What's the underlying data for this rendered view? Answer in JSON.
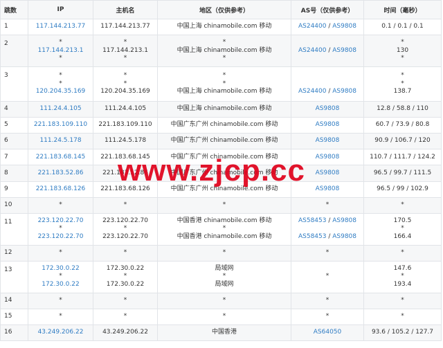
{
  "headers": [
    "跳数",
    "IP",
    "主机名",
    "地区（仅供参考）",
    "AS号（仅供参考）",
    "时间（毫秒）"
  ],
  "rows": [
    {
      "hop": "1",
      "lines": [
        {
          "ip": "117.144.213.77",
          "host": "117.144.213.77",
          "region": "中国上海 chinamobile.com 移动",
          "as1": "AS24400",
          "as2": "AS9808",
          "time": "0.1 / 0.1 / 0.1"
        }
      ]
    },
    {
      "hop": "2",
      "lines": [
        {
          "ip": "*",
          "host": "*",
          "region": "*",
          "as1": "",
          "as2": "",
          "time": "*"
        },
        {
          "ip": "117.144.213.1",
          "host": "117.144.213.1",
          "region": "中国上海 chinamobile.com 移动",
          "as1": "AS24400",
          "as2": "AS9808",
          "time": "130"
        },
        {
          "ip": "*",
          "host": "*",
          "region": "*",
          "as1": "",
          "as2": "",
          "time": "*"
        }
      ]
    },
    {
      "hop": "3",
      "lines": [
        {
          "ip": "*",
          "host": "*",
          "region": "*",
          "as1": "",
          "as2": "",
          "time": "*"
        },
        {
          "ip": "*",
          "host": "*",
          "region": "*",
          "as1": "",
          "as2": "",
          "time": "*"
        },
        {
          "ip": "120.204.35.169",
          "host": "120.204.35.169",
          "region": "中国上海 chinamobile.com 移动",
          "as1": "AS24400",
          "as2": "AS9808",
          "time": "138.7"
        }
      ]
    },
    {
      "hop": "4",
      "lines": [
        {
          "ip": "111.24.4.105",
          "host": "111.24.4.105",
          "region": "中国上海 chinamobile.com 移动",
          "as1": "AS9808",
          "as2": "",
          "time": "12.8 / 58.8 / 110"
        }
      ]
    },
    {
      "hop": "5",
      "lines": [
        {
          "ip": "221.183.109.110",
          "host": "221.183.109.110",
          "region": "中国广东广州 chinamobile.com 移动",
          "as1": "AS9808",
          "as2": "",
          "time": "60.7 / 73.9 / 80.8"
        }
      ]
    },
    {
      "hop": "6",
      "lines": [
        {
          "ip": "111.24.5.178",
          "host": "111.24.5.178",
          "region": "中国广东广州 chinamobile.com 移动",
          "as1": "AS9808",
          "as2": "",
          "time": "90.9 / 106.7 / 120"
        }
      ]
    },
    {
      "hop": "7",
      "lines": [
        {
          "ip": "221.183.68.145",
          "host": "221.183.68.145",
          "region": "中国广东广州 chinamobile.com 移动",
          "as1": "AS9808",
          "as2": "",
          "time": "110.7 / 111.7 / 124.2"
        }
      ]
    },
    {
      "hop": "8",
      "lines": [
        {
          "ip": "221.183.52.86",
          "host": "221.183.52.86",
          "region": "中国广东广州 chinamobile.com 移动",
          "as1": "AS9808",
          "as2": "",
          "time": "96.5 / 99.7 / 111.5"
        }
      ]
    },
    {
      "hop": "9",
      "lines": [
        {
          "ip": "221.183.68.126",
          "host": "221.183.68.126",
          "region": "中国广东广州 chinamobile.com 移动",
          "as1": "AS9808",
          "as2": "",
          "time": "96.5 / 99 / 102.9"
        }
      ]
    },
    {
      "hop": "10",
      "lines": [
        {
          "ip": "*",
          "host": "*",
          "region": "*",
          "as1": "*",
          "as2": "",
          "time": "*"
        }
      ]
    },
    {
      "hop": "11",
      "lines": [
        {
          "ip": "223.120.22.70",
          "host": "223.120.22.70",
          "region": "中国香港 chinamobile.com 移动",
          "as1": "AS58453",
          "as2": "AS9808",
          "time": "170.5"
        },
        {
          "ip": "*",
          "host": "*",
          "region": "*",
          "as1": "",
          "as2": "",
          "time": "*"
        },
        {
          "ip": "223.120.22.70",
          "host": "223.120.22.70",
          "region": "中国香港 chinamobile.com 移动",
          "as1": "AS58453",
          "as2": "AS9808",
          "time": "166.4"
        }
      ]
    },
    {
      "hop": "12",
      "lines": [
        {
          "ip": "*",
          "host": "*",
          "region": "*",
          "as1": "*",
          "as2": "",
          "time": "*"
        }
      ]
    },
    {
      "hop": "13",
      "lines": [
        {
          "ip": "172.30.0.22",
          "host": "172.30.0.22",
          "region": "局域网",
          "as1": "",
          "as2": "",
          "time": "147.6"
        },
        {
          "ip": "*",
          "host": "*",
          "region": "*",
          "as1": "*",
          "as2": "",
          "time": "*"
        },
        {
          "ip": "172.30.0.22",
          "host": "172.30.0.22",
          "region": "局域网",
          "as1": "",
          "as2": "",
          "time": "193.4"
        }
      ]
    },
    {
      "hop": "14",
      "lines": [
        {
          "ip": "*",
          "host": "*",
          "region": "*",
          "as1": "*",
          "as2": "",
          "time": "*"
        }
      ]
    },
    {
      "hop": "15",
      "lines": [
        {
          "ip": "*",
          "host": "*",
          "region": "*",
          "as1": "*",
          "as2": "",
          "time": "*"
        }
      ]
    },
    {
      "hop": "16",
      "lines": [
        {
          "ip": "43.249.206.22",
          "host": "43.249.206.22",
          "region": "中国香港",
          "as1": "AS64050",
          "as2": "",
          "time": "93.6 / 105.2 / 127.7"
        }
      ]
    }
  ],
  "watermark": "www.zjcp.cc",
  "colors": {
    "link": "#2f7cc3",
    "header_bg": "#f6f7f8",
    "border": "#e1e4e8",
    "watermark": "#e0001a"
  }
}
